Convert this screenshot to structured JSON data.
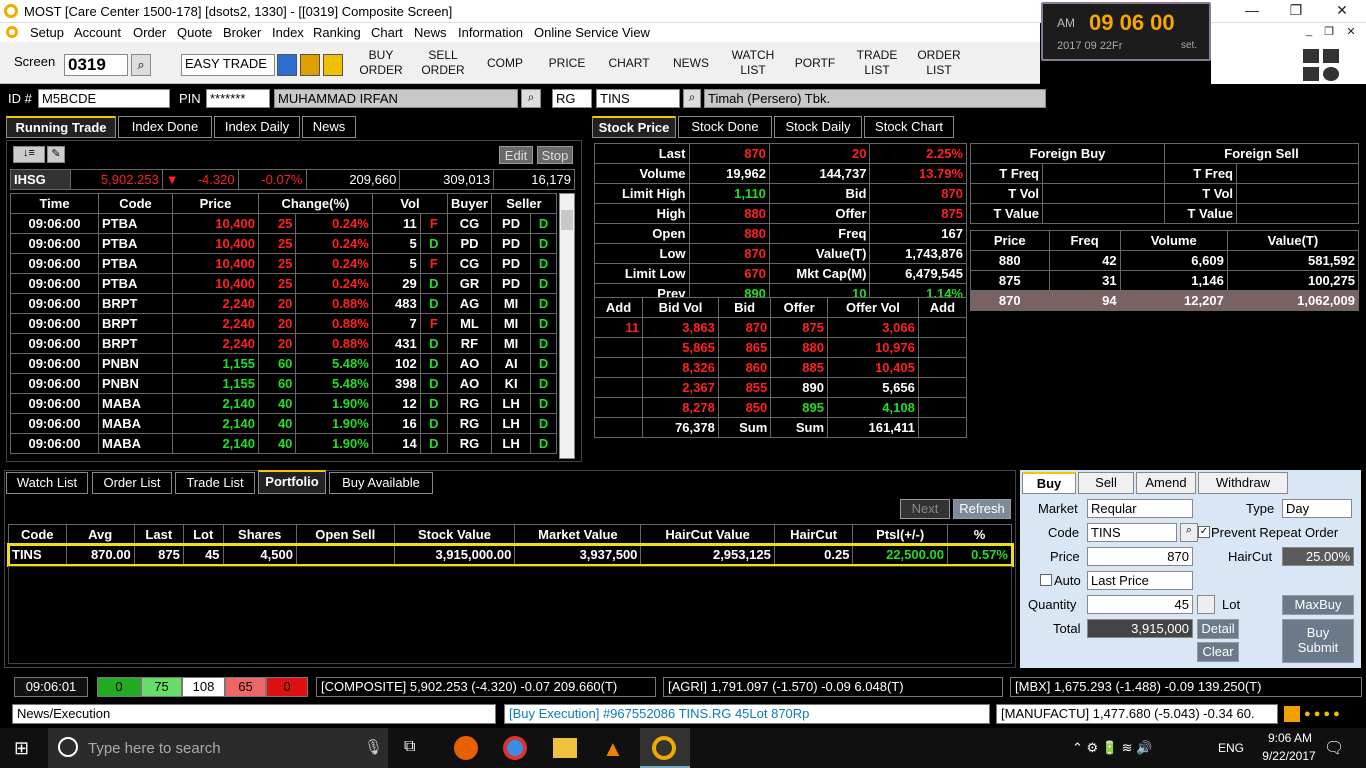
{
  "window": {
    "title": "MOST  [Care Center 1500-178]  [dsots2, 1330] - [[0319] Composite Screen]"
  },
  "menu": [
    "Setup",
    "Account",
    "Order",
    "Quote",
    "Broker",
    "Index",
    "Ranking",
    "Chart",
    "News",
    "Information",
    "Online Service",
    "View"
  ],
  "toolbar": {
    "screen_label": "Screen",
    "screen_value": "0319",
    "mode": "EASY TRADE",
    "buttons": [
      "BUY ORDER",
      "SELL ORDER",
      "COMP",
      "PRICE",
      "CHART",
      "NEWS",
      "WATCH LIST",
      "PORTF",
      "TRADE LIST",
      "ORDER LIST"
    ]
  },
  "clock": {
    "ampm": "AM",
    "time": "09 06 00",
    "date": "2017 09 22Fr",
    "set": "set."
  },
  "idbar": {
    "id_label": "ID #",
    "id_value": "M5BCDE",
    "pin_label": "PIN",
    "pin_value": "*******",
    "name": "MUHAMMAD IRFAN",
    "board": "RG",
    "stock": "TINS",
    "stock_name": "Timah (Persero) Tbk."
  },
  "left_tabs": [
    "Running Trade",
    "Index Done",
    "Index Daily",
    "News"
  ],
  "right_tabs": [
    "Stock Price",
    "Stock Done",
    "Stock Daily",
    "Stock Chart"
  ],
  "rt_buttons": {
    "edit": "Edit",
    "stop": "Stop"
  },
  "ihsg": {
    "name": "IHSG",
    "value": "5,902.253",
    "chg": "-4.320",
    "pct": "-0.07%",
    "v1": "209,660",
    "v2": "309,013",
    "v3": "16,179"
  },
  "running_trade": {
    "headers": [
      "Time",
      "Code",
      "Price",
      "Change(%)",
      "",
      "Vol",
      "",
      "Buyer",
      "Seller",
      ""
    ],
    "rows": [
      [
        "09:06:00",
        "PTBA",
        "10,400",
        "25",
        "0.24%",
        "11",
        "F",
        "CG",
        "PD",
        "D",
        "r"
      ],
      [
        "09:06:00",
        "PTBA",
        "10,400",
        "25",
        "0.24%",
        "5",
        "D",
        "PD",
        "PD",
        "D",
        "r"
      ],
      [
        "09:06:00",
        "PTBA",
        "10,400",
        "25",
        "0.24%",
        "5",
        "F",
        "CG",
        "PD",
        "D",
        "r"
      ],
      [
        "09:06:00",
        "PTBA",
        "10,400",
        "25",
        "0.24%",
        "29",
        "D",
        "GR",
        "PD",
        "D",
        "r"
      ],
      [
        "09:06:00",
        "BRPT",
        "2,240",
        "20",
        "0.88%",
        "483",
        "D",
        "AG",
        "MI",
        "D",
        "r"
      ],
      [
        "09:06:00",
        "BRPT",
        "2,240",
        "20",
        "0.88%",
        "7",
        "F",
        "ML",
        "MI",
        "D",
        "r"
      ],
      [
        "09:06:00",
        "BRPT",
        "2,240",
        "20",
        "0.88%",
        "431",
        "D",
        "RF",
        "MI",
        "D",
        "r"
      ],
      [
        "09:06:00",
        "PNBN",
        "1,155",
        "60",
        "5.48%",
        "102",
        "D",
        "AO",
        "AI",
        "D",
        "g"
      ],
      [
        "09:06:00",
        "PNBN",
        "1,155",
        "60",
        "5.48%",
        "398",
        "D",
        "AO",
        "KI",
        "D",
        "g"
      ],
      [
        "09:06:00",
        "MABA",
        "2,140",
        "40",
        "1.90%",
        "12",
        "D",
        "RG",
        "LH",
        "D",
        "g"
      ],
      [
        "09:06:00",
        "MABA",
        "2,140",
        "40",
        "1.90%",
        "16",
        "D",
        "RG",
        "LH",
        "D",
        "g"
      ],
      [
        "09:06:00",
        "MABA",
        "2,140",
        "40",
        "1.90%",
        "14",
        "D",
        "RG",
        "LH",
        "D",
        "g"
      ]
    ]
  },
  "stock_price": {
    "rows": [
      [
        "Last",
        "870",
        "",
        "20",
        "",
        "2.25%"
      ],
      [
        "Volume",
        "19,962",
        "",
        "144,737",
        "",
        "13.79%"
      ],
      [
        "Limit High",
        "1,110",
        "",
        "Bid",
        "",
        "870"
      ],
      [
        "High",
        "880",
        "",
        "Offer",
        "",
        "875"
      ],
      [
        "Open",
        "880",
        "",
        "Freq",
        "",
        "167"
      ],
      [
        "Low",
        "870",
        "",
        "Value(T)",
        "",
        "1,743,876"
      ],
      [
        "Limit Low",
        "670",
        "",
        "Mkt Cap(M)",
        "",
        "6,479,545"
      ],
      [
        "Prev",
        "890",
        "",
        "10",
        "",
        "1.14%"
      ]
    ]
  },
  "orderbook": {
    "headers": [
      "Add",
      "Bid Vol",
      "Bid",
      "Offer",
      "Offer Vol",
      "Add"
    ],
    "rows": [
      [
        "11",
        "3,863",
        "870",
        "875",
        "3,066",
        ""
      ],
      [
        "",
        "5,865",
        "865",
        "880",
        "10,976",
        ""
      ],
      [
        "",
        "8,326",
        "860",
        "885",
        "10,405",
        ""
      ],
      [
        "",
        "2,367",
        "855",
        "890",
        "5,656",
        ""
      ],
      [
        "",
        "8,278",
        "850",
        "895",
        "4,108",
        ""
      ],
      [
        "",
        "76,378",
        "Sum",
        "Sum",
        "161,411",
        ""
      ]
    ]
  },
  "foreign": {
    "buy": "Foreign Buy",
    "sell": "Foreign Sell",
    "labels": [
      "T Freq",
      "T Vol",
      "T Value"
    ]
  },
  "done": {
    "headers": [
      "Price",
      "Freq",
      "Volume",
      "Value(T)"
    ],
    "rows": [
      [
        "880",
        "42",
        "6,609",
        "581,592"
      ],
      [
        "875",
        "31",
        "1,146",
        "100,275"
      ],
      [
        "870",
        "94",
        "12,207",
        "1,062,009"
      ]
    ]
  },
  "bottom_tabs": [
    "Watch List",
    "Order List",
    "Trade List",
    "Portfolio",
    "Buy Available"
  ],
  "portfolio_buttons": {
    "next": "Next",
    "refresh": "Refresh"
  },
  "portfolio": {
    "headers": [
      "Code",
      "Avg",
      "Last",
      "Lot",
      "Shares",
      "Open Sell",
      "Stock Value",
      "Market Value",
      "HairCut Value",
      "HairCut",
      "Ptsl(+/-)",
      "%"
    ],
    "row": [
      "TINS",
      "870.00",
      "875",
      "45",
      "4,500",
      "",
      "3,915,000.00",
      "3,937,500",
      "2,953,125",
      "0.25",
      "22,500.00",
      "0.57%"
    ]
  },
  "order_tabs": [
    "Buy",
    "Sell",
    "Amend",
    "Withdraw"
  ],
  "order": {
    "market_label": "Market",
    "market": "Reqular",
    "type_label": "Type",
    "type": "Day",
    "code_label": "Code",
    "code": "TINS",
    "prevent": "Prevent Repeat Order",
    "price_label": "Price",
    "price": "870",
    "haircut_label": "HairCut",
    "haircut": "25.00%",
    "auto": "Auto",
    "auto_value": "Last Price",
    "qty_label": "Quantity",
    "qty": "45",
    "lot": "Lot",
    "maxbuy": "MaxBuy",
    "total_label": "Total",
    "total": "3,915,000",
    "detail": "Detail",
    "clear": "Clear",
    "submit": "Buy\nSubmit"
  },
  "status": {
    "time": "09:06:01",
    "counts": [
      "0",
      "75",
      "108",
      "65",
      "0"
    ],
    "composite": "[COMPOSITE]  5,902.253  (-4.320)  -0.07  209.660(T)",
    "agri": "[AGRI]  1,791.097  (-1.570)  -0.09  6.048(T)",
    "mbx": "[MBX]  1,675.293  (-1.488)  -0.09  139.250(T)"
  },
  "news": {
    "label": "News/Execution",
    "exec": "[Buy Execution] #967552086  TINS.RG  45Lot  870Rp",
    "manu": "[MANUFACTU]  1,477.680  (-5.043)  -0.34  60."
  },
  "taskbar": {
    "search": "Type here to search",
    "time": "9:06 AM",
    "date": "9/22/2017",
    "lang": "ENG"
  }
}
